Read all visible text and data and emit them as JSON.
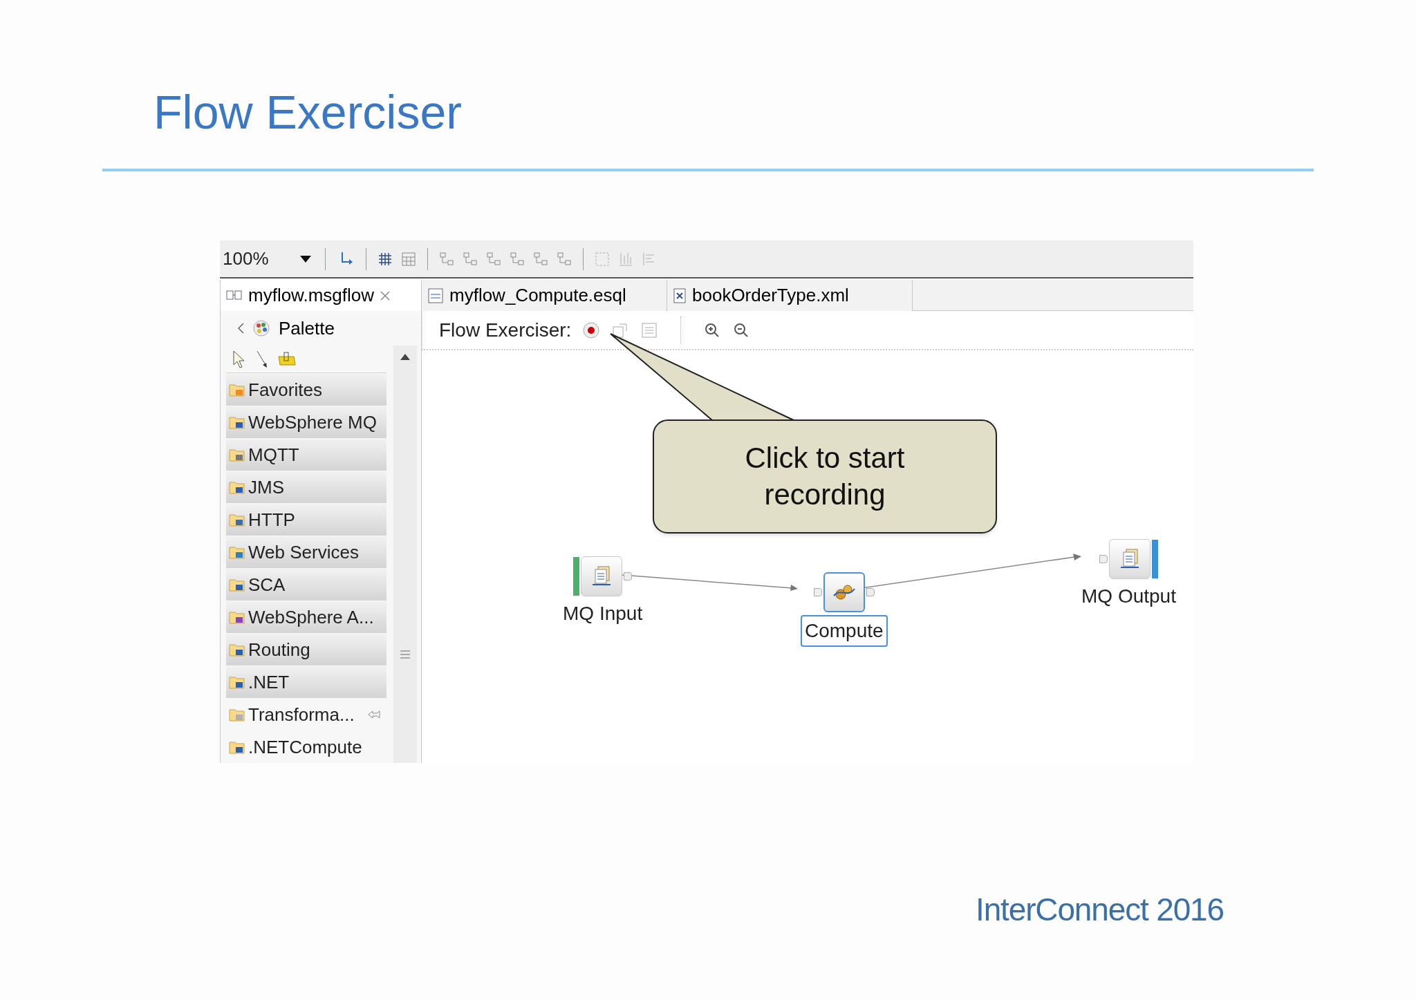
{
  "slide": {
    "title": "Flow Exerciser",
    "footer": "InterConnect 2016"
  },
  "toolbar": {
    "zoom": "100%"
  },
  "tabs": [
    {
      "label": "myflow.msgflow",
      "kind": "flow",
      "selected": true,
      "closable": true
    },
    {
      "label": "myflow_Compute.esql",
      "kind": "esql",
      "selected": false,
      "closable": false
    },
    {
      "label": "bookOrderType.xml",
      "kind": "xml",
      "selected": false,
      "closable": false
    }
  ],
  "palette": {
    "title": "Palette",
    "items": [
      {
        "label": "Favorites",
        "kind": "drawer",
        "expanded": false
      },
      {
        "label": "WebSphere MQ",
        "kind": "drawer",
        "expanded": false
      },
      {
        "label": "MQTT",
        "kind": "drawer",
        "expanded": false
      },
      {
        "label": "JMS",
        "kind": "drawer",
        "expanded": false
      },
      {
        "label": "HTTP",
        "kind": "drawer",
        "expanded": false
      },
      {
        "label": "Web Services",
        "kind": "drawer",
        "expanded": false
      },
      {
        "label": "SCA",
        "kind": "drawer",
        "expanded": false
      },
      {
        "label": "WebSphere A...",
        "kind": "drawer",
        "expanded": false
      },
      {
        "label": "Routing",
        "kind": "drawer",
        "expanded": false
      },
      {
        "label": ".NET",
        "kind": "drawer",
        "expanded": false
      },
      {
        "label": "Transforma...",
        "kind": "drawer",
        "expanded": true
      },
      {
        "label": ".NETCompute",
        "kind": "node"
      }
    ]
  },
  "editor": {
    "label": "Flow Exerciser:"
  },
  "callout": {
    "text": "Click to start recording"
  },
  "nodes": [
    {
      "label": "MQ Input",
      "kind": "input",
      "selected": false
    },
    {
      "label": "Compute",
      "kind": "compute",
      "selected": true
    },
    {
      "label": "MQ Output",
      "kind": "output",
      "selected": false
    }
  ]
}
